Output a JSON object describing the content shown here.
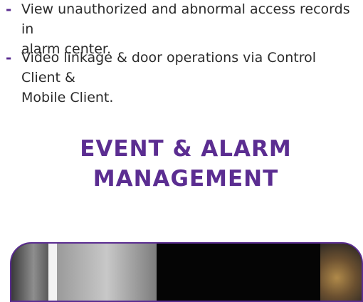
{
  "bullets": [
    {
      "dash": "-",
      "text": "View unauthorized and abnormal access records in\nalarm center."
    },
    {
      "dash": "-",
      "text": "Video linkage & door operations via Control Client &\nMobile Client."
    }
  ],
  "section_heading": "EVENT & ALARM\nMANAGEMENT",
  "colors": {
    "accent": "#5b2d91",
    "text": "#2b2b2b"
  }
}
